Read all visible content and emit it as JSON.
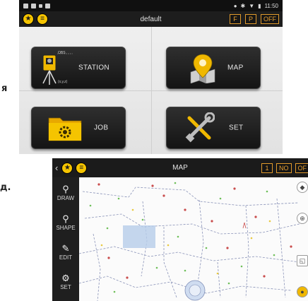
{
  "left_labels": {
    "top": "я",
    "bottom": "д."
  },
  "screen1": {
    "status": {
      "time": "11:50"
    },
    "title": "default",
    "flags": [
      "F",
      "P",
      "OFF"
    ],
    "tiles": {
      "station": {
        "label": "STATION",
        "icon_text_obs": "OBS",
        "icon_text_xyz": "(x,y,z)"
      },
      "map": {
        "label": "MAP"
      },
      "job": {
        "label": "JOB"
      },
      "set": {
        "label": "SET"
      }
    }
  },
  "screen2": {
    "back": "‹",
    "title": "MAP",
    "flags": [
      "1",
      "NO",
      "OF"
    ],
    "sidebar": [
      {
        "label": "DRAW"
      },
      {
        "label": "SHAPE"
      },
      {
        "label": "EDIT"
      },
      {
        "label": "SET"
      }
    ]
  },
  "colors": {
    "accent_yellow": "#f5c400",
    "flag_orange": "#e09a2c",
    "bar_dark": "#1d1d1d"
  }
}
